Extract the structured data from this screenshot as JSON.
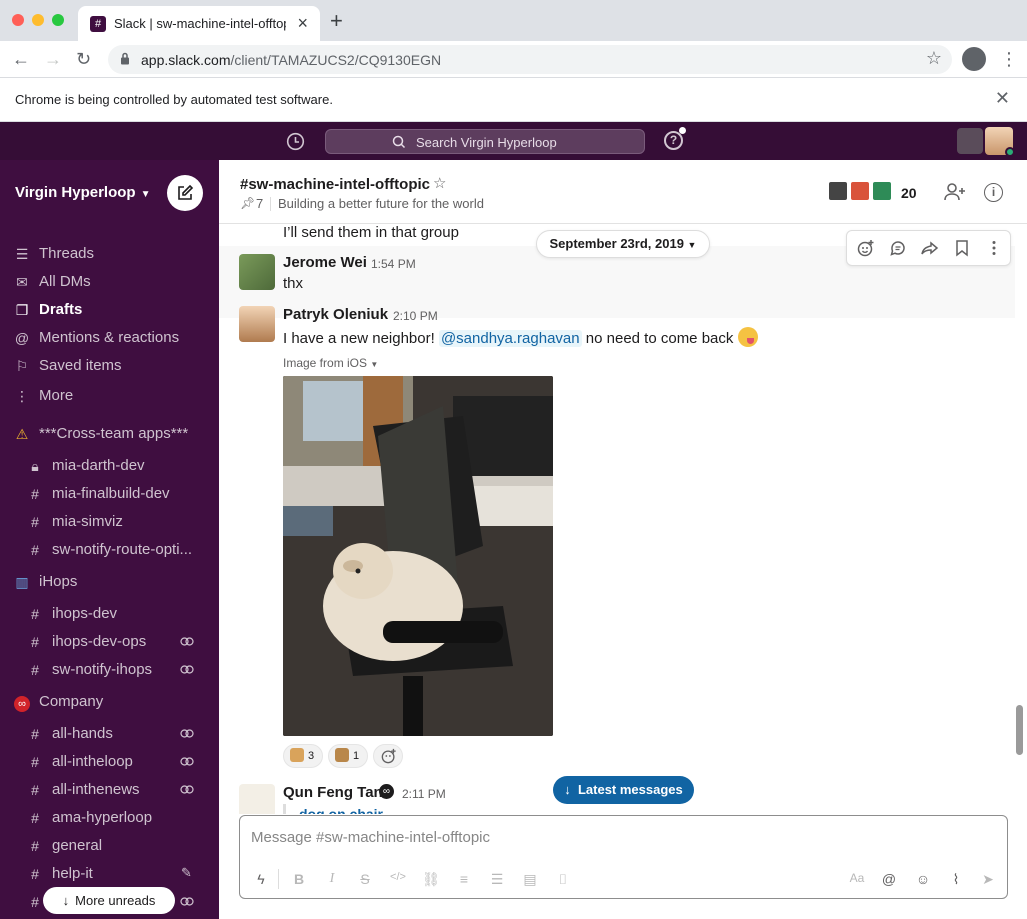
{
  "browser": {
    "tab_title": "Slack | sw-machine-intel-offtopic",
    "url_host": "app.slack.com",
    "url_path": "/client/TAMAZUCS2/CQ9130EGN",
    "infobar": "Chrome is being controlled by automated test software."
  },
  "topbar": {
    "search_placeholder": "Search Virgin Hyperloop"
  },
  "sidebar": {
    "workspace": "Virgin Hyperloop",
    "nav": [
      {
        "label": "Threads",
        "icon": "threads-icon"
      },
      {
        "label": "All DMs",
        "icon": "dms-icon"
      },
      {
        "label": "Drafts",
        "icon": "drafts-icon"
      },
      {
        "label": "Mentions & reactions",
        "icon": "mention-icon"
      },
      {
        "label": "Saved items",
        "icon": "bookmark-icon"
      },
      {
        "label": "More",
        "icon": "more-icon"
      }
    ],
    "sections": [
      {
        "label": "***Cross-team apps***",
        "icon": "warning-icon"
      },
      {
        "label": "iHops",
        "icon": "chart-icon"
      },
      {
        "label": "Company",
        "icon": "infinity-icon"
      }
    ],
    "channels": [
      "mia-darth-dev",
      "mia-finalbuild-dev",
      "mia-simviz",
      "sw-notify-route-opti...",
      "ihops-dev",
      "ihops-dev-ops",
      "sw-notify-ihops",
      "all-hands",
      "all-intheloop",
      "all-inthenews",
      "ama-hyperloop",
      "general",
      "help-it"
    ],
    "more_unreads": "More unreads"
  },
  "channel": {
    "name": "#sw-machine-intel-offtopic",
    "pins": "7",
    "topic": "Building a better future for the world",
    "member_count": "20"
  },
  "messages": {
    "prev_text": "I’ll send them in that group",
    "date_divider": "September 23rd, 2019",
    "m1": {
      "author": "Jerome Wei",
      "time": "1:54 PM",
      "text": "thx"
    },
    "m2": {
      "author": "Patryk Oleniuk",
      "time": "2:10 PM",
      "text_before": "I have a new neighbor!",
      "mention": "@sandhya.raghavan",
      "text_after": "no need to come back",
      "image_label": "Image from iOS",
      "reactions": [
        "3",
        "1"
      ]
    },
    "m3": {
      "author": "Qun Feng Tan",
      "time": "2:11 PM",
      "attachment": "dog on chair"
    },
    "latest_button": "Latest messages"
  },
  "composer": {
    "placeholder": "Message #sw-machine-intel-offtopic"
  },
  "colors": {
    "sidebar": "#3f0e40",
    "topbar": "#350d36",
    "link": "#1264a3",
    "latest": "#1164a3"
  }
}
